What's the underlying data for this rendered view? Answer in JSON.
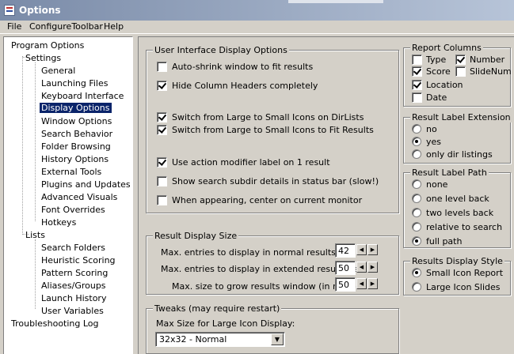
{
  "window": {
    "title": "Options"
  },
  "menu": [
    "File",
    "ConfigureToolbar",
    "Help"
  ],
  "tree": {
    "root": "Program Options",
    "settings": "Settings",
    "settings_items": [
      "General",
      "Launching Files",
      "Keyboard Interface",
      "Display Options",
      "Window Options",
      "Search Behavior",
      "Folder Browsing",
      "History Options",
      "External Tools",
      "Plugins and Updates",
      "Advanced Visuals",
      "Font Overrides",
      "Hotkeys"
    ],
    "selected": "Display Options",
    "lists": "Lists",
    "lists_items": [
      "Search Folders",
      "Heuristic Scoring",
      "Pattern Scoring",
      "Aliases/Groups",
      "Launch History",
      "User Variables"
    ],
    "troubleshooting": "Troubleshooting Log"
  },
  "ui_display": {
    "title": "User Interface Display Options",
    "options": [
      {
        "label": "Auto-shrink window to fit results",
        "checked": false
      },
      {
        "label": "Hide Column Headers completely",
        "checked": true
      },
      {
        "label": "Switch from Large to Small Icons on DirLists",
        "checked": true
      },
      {
        "label": "Switch from Large to Small Icons to Fit Results",
        "checked": true
      },
      {
        "label": "Use action modifier label on 1 result",
        "checked": true
      },
      {
        "label": "Show search subdir details in status bar (slow!)",
        "checked": false
      },
      {
        "label": "When appearing, center on current monitor",
        "checked": false
      }
    ]
  },
  "result_size": {
    "title": "Result Display Size",
    "rows": [
      {
        "label": "Max. entries to display in normal results list:",
        "value": "42"
      },
      {
        "label": "Max. entries to display in extended results list:",
        "value": "50"
      },
      {
        "label": "Max. size to grow results window (in rows):",
        "value": "50"
      }
    ]
  },
  "tweaks": {
    "title": "Tweaks (may require restart)",
    "label": "Max Size for Large Icon Display:",
    "value": "32x32 - Normal"
  },
  "report_columns": {
    "title": "Report Columns",
    "items": [
      {
        "label": "Type",
        "checked": false
      },
      {
        "label": "Number",
        "checked": true
      },
      {
        "label": "Score",
        "checked": true
      },
      {
        "label": "SlideNum",
        "checked": false
      },
      {
        "label": "Location",
        "checked": true
      },
      {
        "label": "Date",
        "checked": false
      }
    ]
  },
  "label_extension": {
    "title": "Result Label Extension",
    "options": [
      "no",
      "yes",
      "only dir listings"
    ],
    "selected": "yes"
  },
  "label_path": {
    "title": "Result Label Path",
    "options": [
      "none",
      "one level back",
      "two levels back",
      "relative to search",
      "full path"
    ],
    "selected": "full path"
  },
  "display_style": {
    "title": "Results Display Style",
    "options": [
      "Small Icon Report",
      "Large Icon Slides"
    ],
    "selected": "Small Icon Report"
  }
}
